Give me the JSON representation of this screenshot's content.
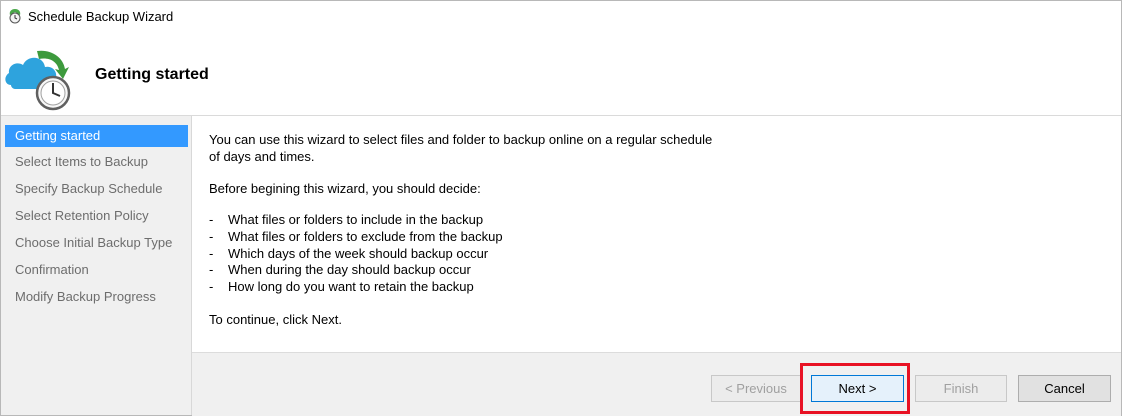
{
  "window": {
    "title": "Schedule Backup Wizard"
  },
  "header": {
    "title": "Getting started"
  },
  "sidebar": {
    "items": [
      {
        "label": "Getting started",
        "active": true
      },
      {
        "label": "Select Items to Backup",
        "active": false
      },
      {
        "label": "Specify Backup Schedule",
        "active": false
      },
      {
        "label": "Select Retention Policy",
        "active": false
      },
      {
        "label": "Choose Initial Backup Type",
        "active": false
      },
      {
        "label": "Confirmation",
        "active": false
      },
      {
        "label": "Modify Backup Progress",
        "active": false
      }
    ]
  },
  "content": {
    "intro_line1": "You can use this wizard to select files and folder to backup online on a regular schedule",
    "intro_line2": "of days and times.",
    "decide": "Before begining this wizard, you should decide:",
    "bullets": [
      "What files or folders to include in the backup",
      "What files or folders to exclude from the backup",
      "Which days of the week should backup occur",
      "When during the day should backup occur",
      "How long do you want to retain the backup"
    ],
    "bullet_marker": "-",
    "continue": "To continue, click Next."
  },
  "buttons": {
    "previous": "< Previous",
    "next": "Next >",
    "finish": "Finish",
    "cancel": "Cancel"
  },
  "colors": {
    "active_nav": "#3399ff",
    "highlight": "#e81123"
  },
  "icons": {
    "title": "backup-agent-icon",
    "wizard": "cloud-clock-backup-icon"
  }
}
